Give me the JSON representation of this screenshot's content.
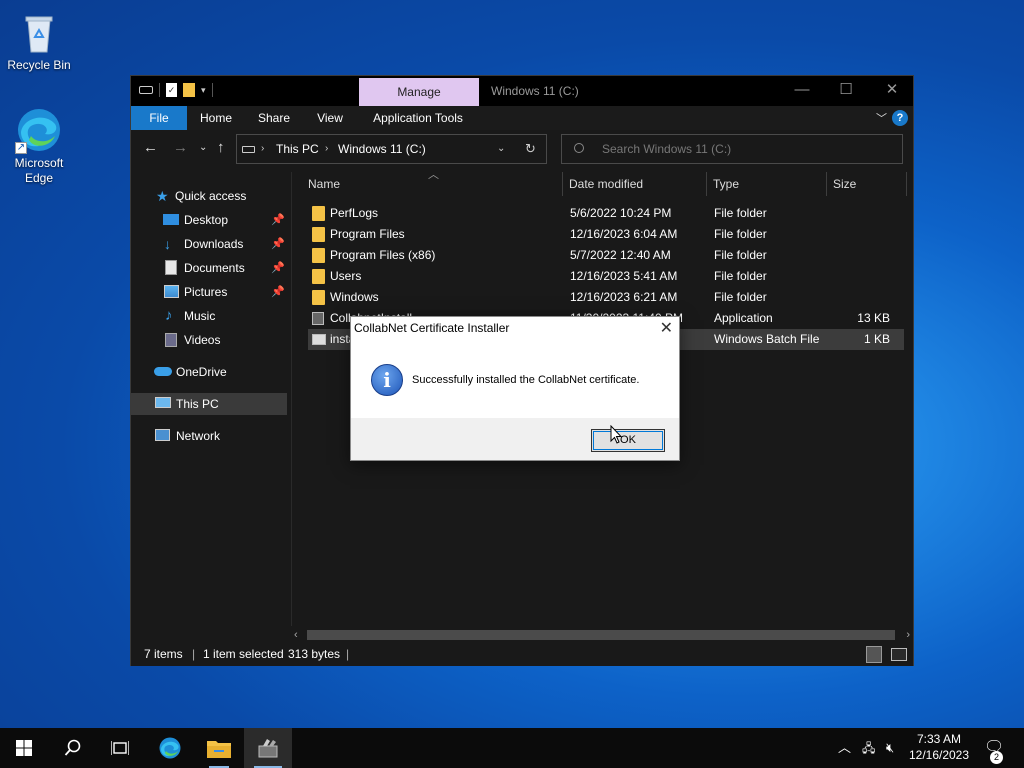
{
  "desktop": {
    "icons": [
      {
        "label": "Recycle Bin",
        "icon": "recycle-bin-icon"
      },
      {
        "label": "Microsoft Edge",
        "icon": "edge-icon"
      }
    ]
  },
  "explorer": {
    "title": "Windows 11 (C:)",
    "manage_tab": "Manage",
    "ribbon_tabs": [
      "File",
      "Home",
      "Share",
      "View",
      "Application Tools"
    ],
    "address": {
      "crumbs": [
        "This PC",
        "Windows 11 (C:)"
      ]
    },
    "search_placeholder": "Search Windows 11 (C:)",
    "nav": {
      "quick_access": "Quick access",
      "items": [
        "Desktop",
        "Downloads",
        "Documents",
        "Pictures",
        "Music",
        "Videos"
      ],
      "onedrive": "OneDrive",
      "this_pc": "This PC",
      "network": "Network"
    },
    "columns": [
      "Name",
      "Date modified",
      "Type",
      "Size"
    ],
    "files": [
      {
        "name": "PerfLogs",
        "date": "5/6/2022 10:24 PM",
        "type": "File folder",
        "size": "",
        "kind": "folder"
      },
      {
        "name": "Program Files",
        "date": "12/16/2023 6:04 AM",
        "type": "File folder",
        "size": "",
        "kind": "folder"
      },
      {
        "name": "Program Files (x86)",
        "date": "5/7/2022 12:40 AM",
        "type": "File folder",
        "size": "",
        "kind": "folder"
      },
      {
        "name": "Users",
        "date": "12/16/2023 5:41 AM",
        "type": "File folder",
        "size": "",
        "kind": "folder"
      },
      {
        "name": "Windows",
        "date": "12/16/2023 6:21 AM",
        "type": "File folder",
        "size": "",
        "kind": "folder"
      },
      {
        "name": "CollabnetInstall...",
        "date": "11/30/2023 11:40 PM",
        "type": "Application",
        "size": "13 KB",
        "kind": "app"
      },
      {
        "name": "insta",
        "date": "",
        "type": "Windows Batch File",
        "size": "1 KB",
        "kind": "bat"
      }
    ],
    "status": {
      "items": "7 items",
      "selected": "1 item selected",
      "size": "313 bytes"
    }
  },
  "dialog": {
    "title": "CollabNet Certificate Installer",
    "message": "Successfully installed the CollabNet certificate.",
    "ok_label": "OK"
  },
  "taskbar": {
    "time": "7:33 AM",
    "date": "12/16/2023",
    "notification_count": "2"
  },
  "colors": {
    "accent": "#1979ca",
    "manage_tab": "#e0c7f0",
    "folder": "#f4c246"
  }
}
